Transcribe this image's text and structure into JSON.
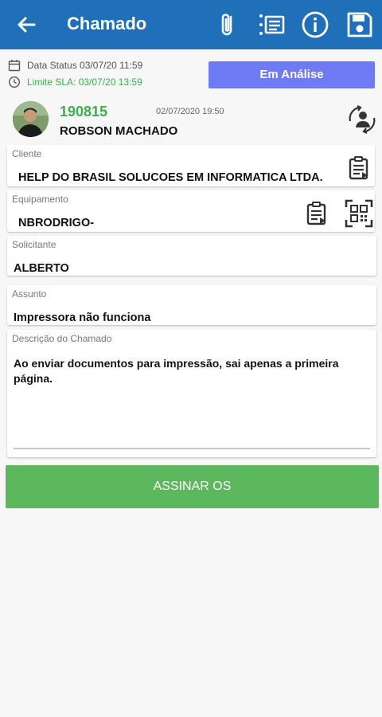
{
  "appbar": {
    "title": "Chamado"
  },
  "status": {
    "data_status": "Data Status 03/07/20 11:59",
    "limite_sla": "Limite SLA: 03/07/20 13:59",
    "badge": "Em Análise"
  },
  "technician": {
    "ticket_number": "190815",
    "date": "02/07/2020 19:50",
    "name": "ROBSON MACHADO"
  },
  "fields": {
    "cliente": {
      "label": "Cliente",
      "value": "HELP DO BRASIL SOLUCOES EM INFORMATICA LTDA."
    },
    "equipamento": {
      "label": "Equipamento",
      "value": "NBRODRIGO-"
    },
    "solicitante": {
      "label": "Solicitante",
      "value": "ALBERTO"
    },
    "assunto": {
      "label": "Assunto",
      "value": "Impressora  não funciona"
    },
    "descricao": {
      "label": "Descrição do Chamado",
      "value": "Ao enviar documentos para impressão, sai apenas a primeira página."
    }
  },
  "sign_button": {
    "label": "ASSINAR OS"
  },
  "colors": {
    "appbar": "#1f6fb9",
    "badge": "#6f7af5",
    "ticket": "#3cae4b",
    "sla": "#3cae4b",
    "sign": "#5cb85c"
  }
}
